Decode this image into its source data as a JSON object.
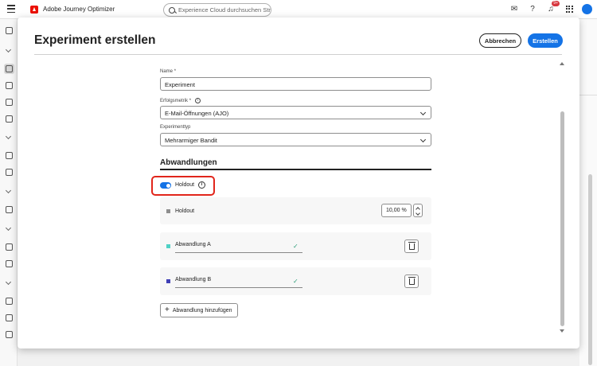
{
  "app": {
    "title": "Adobe Journey Optimizer",
    "search_placeholder": "Experience Cloud durchsuchen Str...",
    "notification_badge": "9+"
  },
  "modal": {
    "title": "Experiment erstellen",
    "cancel_label": "Abbrechen",
    "create_label": "Erstellen",
    "fields": {
      "name_label": "Name",
      "name_value": "Experiment",
      "metric_label": "Erfolgsmetrik",
      "metric_value": "E-Mail-Öffnungen (AJO)",
      "type_label": "Experimenttyp",
      "type_value": "Mehrarmiger Bandit",
      "required_mark": "*"
    },
    "variations": {
      "section_title": "Abwandlungen",
      "holdout_toggle_label": "Holdout",
      "holdout_enabled": true,
      "holdout_row_label": "Holdout",
      "holdout_percent": "10,00 %",
      "items": [
        {
          "label": "Abwandlung A",
          "color": "#4fd1c5"
        },
        {
          "label": "Abwandlung B",
          "color": "#3f3fb5"
        }
      ],
      "add_label": "Abwandlung hinzufügen"
    }
  },
  "colors": {
    "accent": "#1473e6",
    "highlight": "#e1251b",
    "holdout_swatch": "#8e8e8e"
  }
}
